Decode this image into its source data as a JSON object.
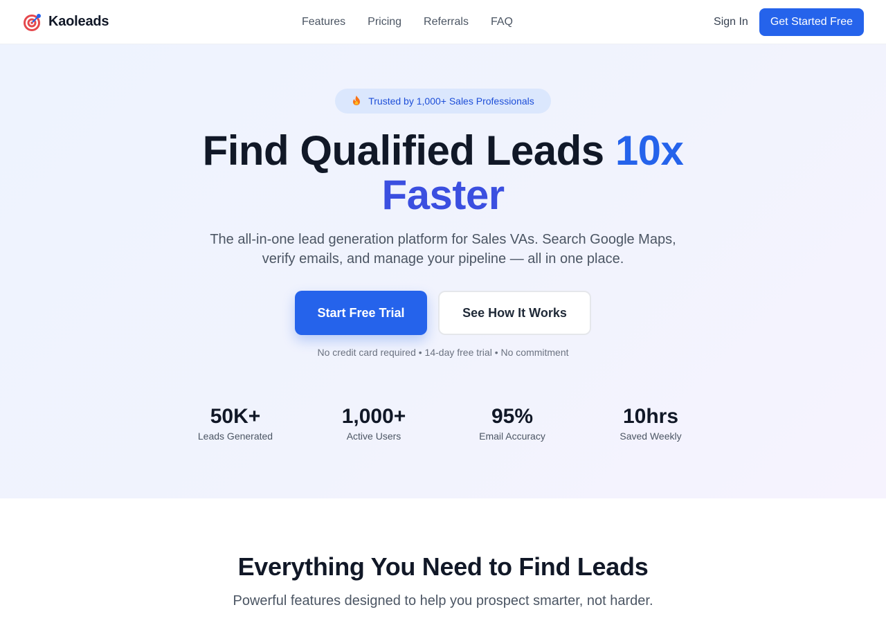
{
  "brand": {
    "name": "Kaoleads",
    "icon": "target-icon",
    "colors": {
      "ring": "#e5484d",
      "dot": "#2563eb"
    }
  },
  "nav": {
    "items": [
      "Features",
      "Pricing",
      "Referrals",
      "FAQ"
    ]
  },
  "header": {
    "signin_label": "Sign In",
    "cta_label": "Get Started Free"
  },
  "hero": {
    "badge_icon": "fire-icon",
    "badge_text": "Trusted by 1,000+ Sales Professionals",
    "title_main": "Find Qualified Leads",
    "title_accent_1": "10x",
    "title_accent_2": "Faster",
    "subtitle": "The all-in-one lead generation platform for Sales VAs. Search Google Maps, verify emails, and manage your pipeline — all in one place.",
    "primary_cta": "Start Free Trial",
    "secondary_cta": "See How It Works",
    "fine_print": "No credit card required • 14-day free trial • No commitment"
  },
  "stats": [
    {
      "value": "50K+",
      "label": "Leads Generated"
    },
    {
      "value": "1,000+",
      "label": "Active Users"
    },
    {
      "value": "95%",
      "label": "Email Accuracy"
    },
    {
      "value": "10hrs",
      "label": "Saved Weekly"
    }
  ],
  "features": {
    "title": "Everything You Need to Find Leads",
    "subtitle": "Powerful features designed to help you prospect smarter, not harder."
  },
  "colors": {
    "accent": "#2563eb",
    "accent_alt": "#3b4fe0",
    "text_dark": "#111827",
    "text_muted": "#4b5563"
  }
}
